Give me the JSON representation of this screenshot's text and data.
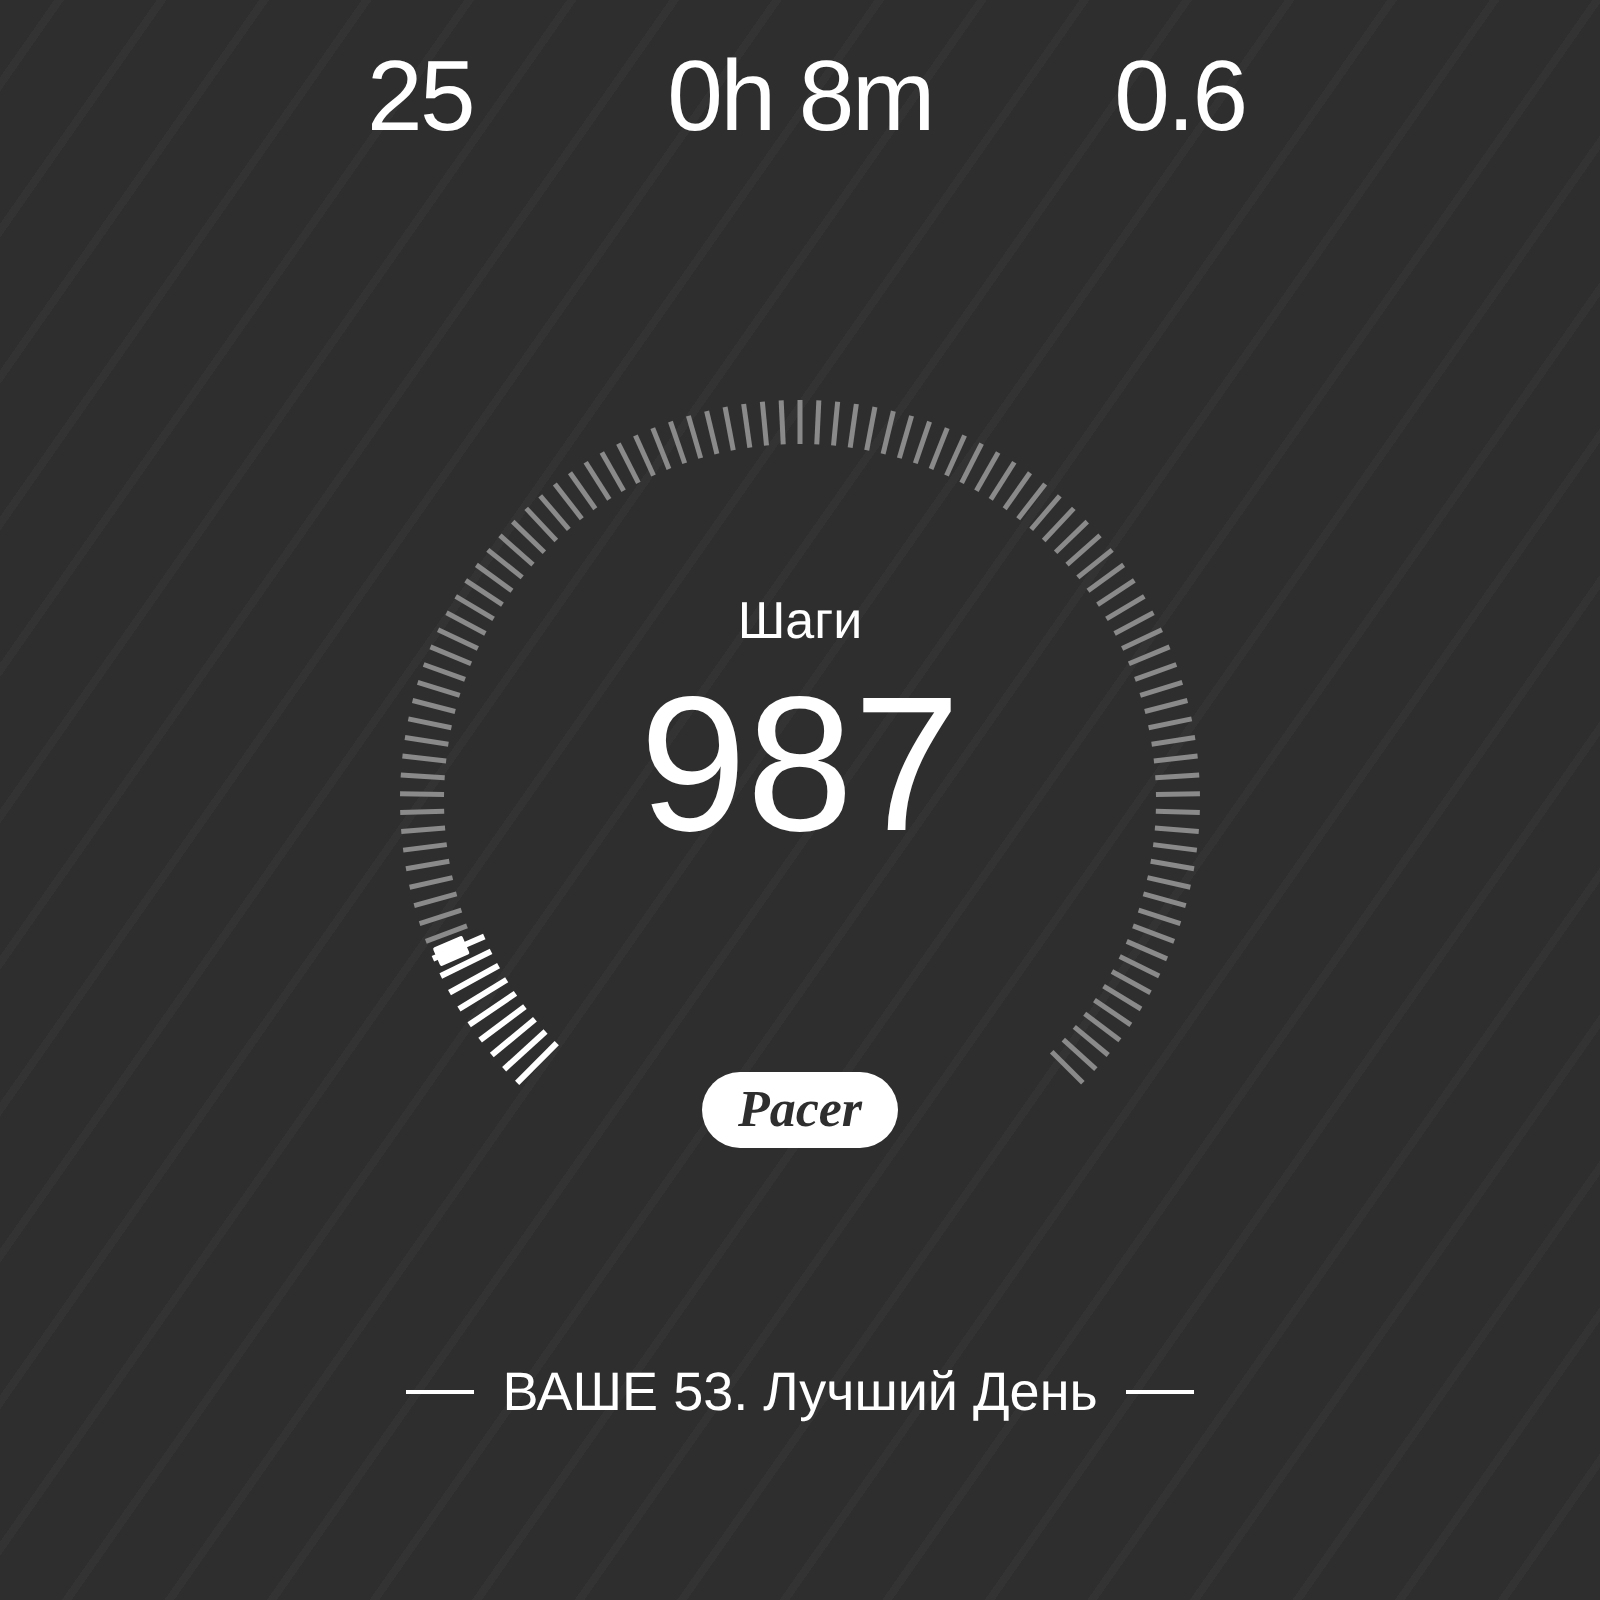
{
  "stats": [
    {
      "value": "25"
    },
    {
      "value": "0h 8m"
    },
    {
      "value": "0.6"
    }
  ],
  "gauge": {
    "label": "Шаги",
    "value": "987"
  },
  "logo": {
    "text": "Pacer"
  },
  "best_day": {
    "text": "ВАШЕ 53. Лучший День"
  }
}
